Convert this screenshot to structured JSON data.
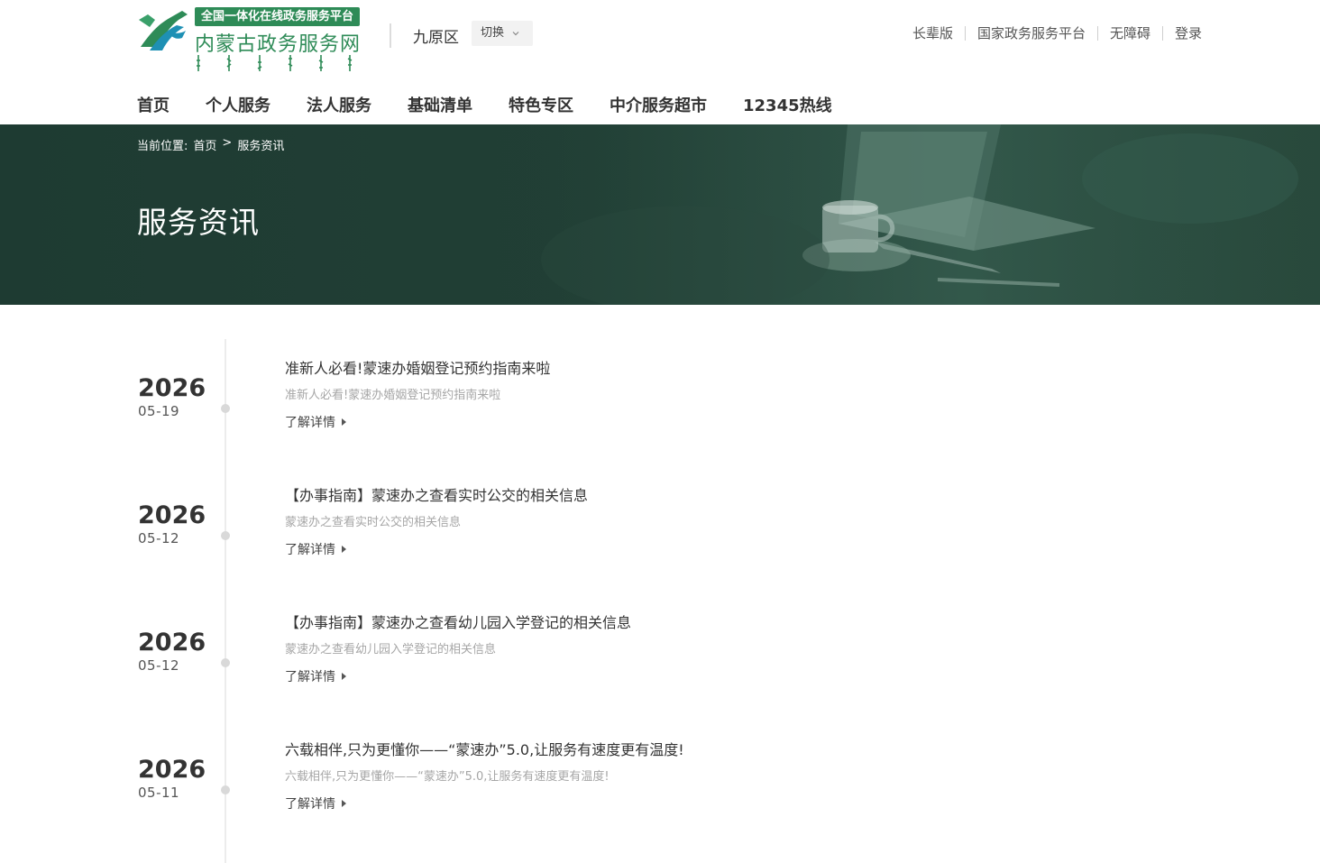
{
  "header": {
    "logo_badge": "全国一体化在线政务服务平台",
    "logo_name": "内蒙古政务服务网",
    "region": "九原区",
    "switch_label": "切换",
    "links": [
      "长辈版",
      "国家政务服务平台",
      "无障碍",
      "登录"
    ]
  },
  "nav": {
    "items": [
      "首页",
      "个人服务",
      "法人服务",
      "基础清单",
      "特色专区",
      "中介服务超市",
      "12345热线"
    ]
  },
  "banner": {
    "breadcrumb_prefix": "当前位置:",
    "breadcrumb_home": "首页",
    "breadcrumb_sep": ">",
    "breadcrumb_current": "服务资讯",
    "title": "服务资讯"
  },
  "news": [
    {
      "year": "2026",
      "date": "05-19",
      "title": "准新人必看!蒙速办婚姻登记预约指南来啦",
      "summary": "准新人必看!蒙速办婚姻登记预约指南来啦",
      "more": "了解详情"
    },
    {
      "year": "2026",
      "date": "05-12",
      "title": "【办事指南】蒙速办之查看实时公交的相关信息",
      "summary": "蒙速办之查看实时公交的相关信息",
      "more": "了解详情"
    },
    {
      "year": "2026",
      "date": "05-12",
      "title": "【办事指南】蒙速办之查看幼儿园入学登记的相关信息",
      "summary": "蒙速办之查看幼儿园入学登记的相关信息",
      "more": "了解详情"
    },
    {
      "year": "2026",
      "date": "05-11",
      "title": "六载相伴,只为更懂你——“蒙速办”5.0,让服务有速度更有温度!",
      "summary": "六载相伴,只为更懂你——“蒙速办”5.0,让服务有速度更有温度!",
      "more": "了解详情"
    }
  ],
  "colors": {
    "brand_green": "#2e8b57",
    "banner_bg": "#213f35"
  }
}
